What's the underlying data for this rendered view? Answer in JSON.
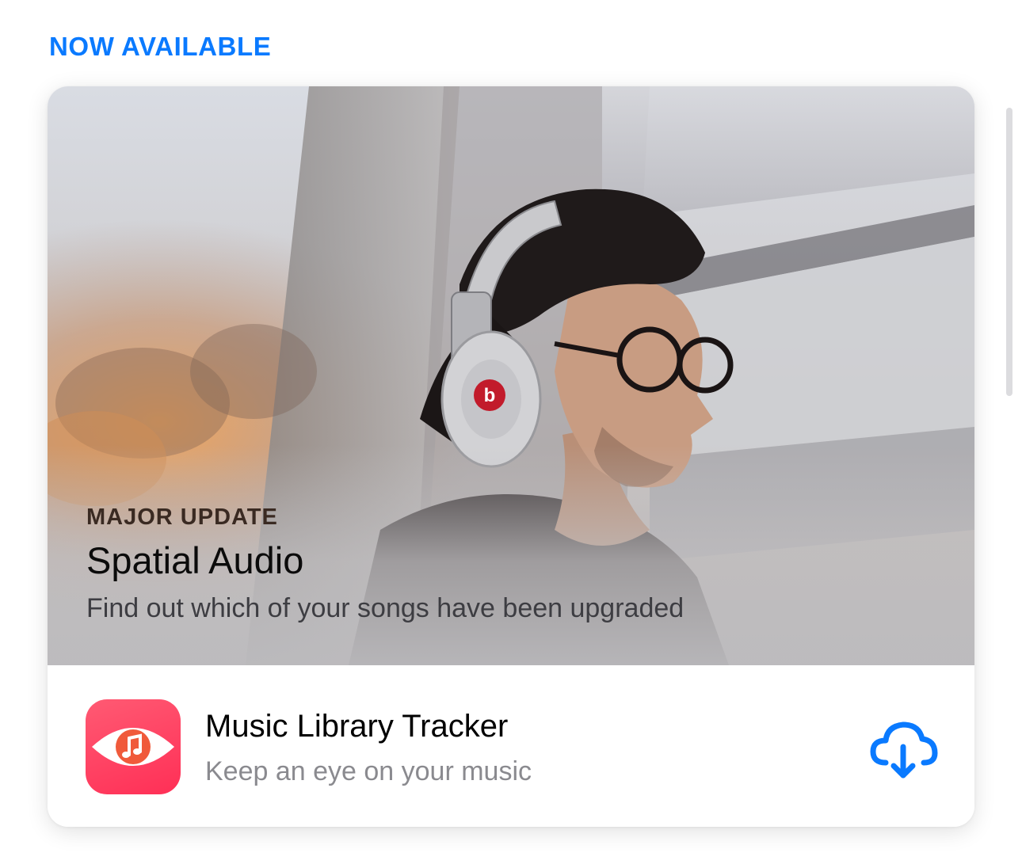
{
  "section": {
    "label": "NOW AVAILABLE"
  },
  "feature": {
    "eyebrow": "MAJOR UPDATE",
    "title": "Spatial Audio",
    "subtitle": "Find out which of your songs have been upgraded"
  },
  "app": {
    "name": "Music Library Tracker",
    "tagline": "Keep an eye on your music",
    "icon": "eye-music-note-icon",
    "action_icon": "cloud-download-icon"
  },
  "colors": {
    "accent": "#0a7aff",
    "app_icon": "#ff3b5c"
  }
}
